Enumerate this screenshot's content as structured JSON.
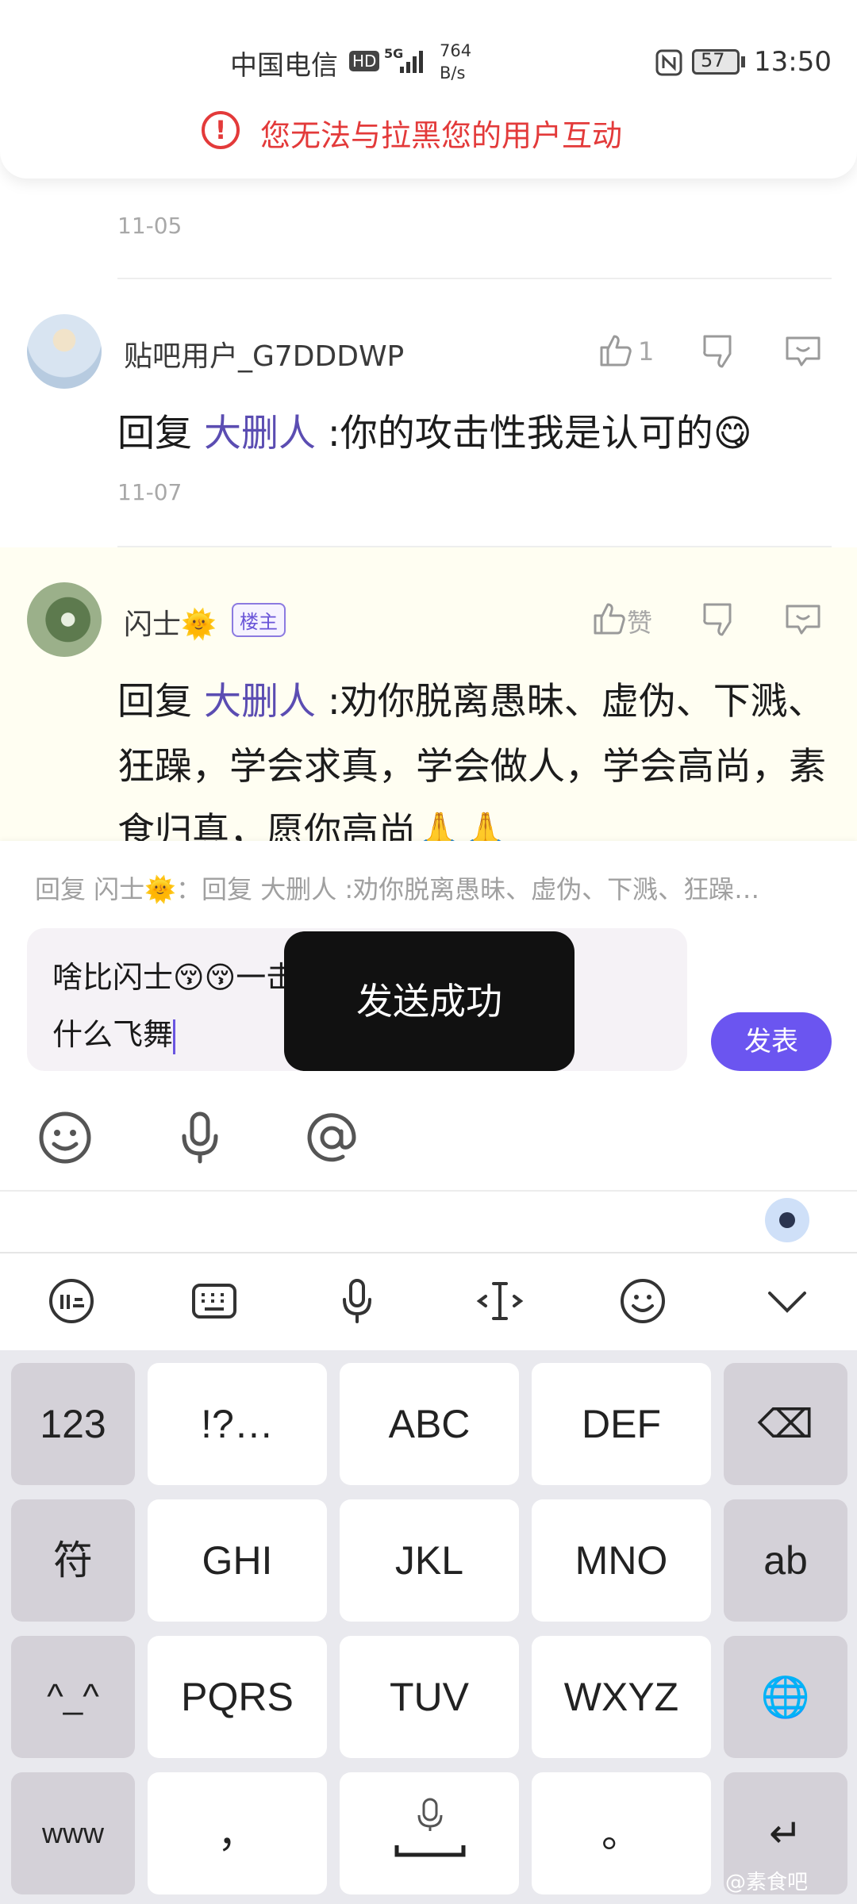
{
  "status_bar": {
    "carrier": "中国电信",
    "hd": "HD",
    "net": "5G",
    "speed_value": "764",
    "speed_unit": "B/s",
    "battery": "57",
    "time": "13:50"
  },
  "banner": {
    "text": "您无法与拉黑您的用户互动"
  },
  "comments": [
    {
      "date": "11-05"
    },
    {
      "user": "贴吧用户_G7DDDWP",
      "reply_prefix": "回复",
      "mention": "大删人",
      "text": ":你的攻击性我是认可的",
      "emoji": "😋",
      "like_count": "1",
      "date": "11-07"
    },
    {
      "user": "闪士🌞",
      "badge": "楼主",
      "reply_prefix": "回复",
      "mention": "大删人",
      "text": ":劝你脱离愚昧、虚伪、下溅、狂躁，学会求真，学会做人，学会高尚，素食归真，愿你高尚🙏🙏",
      "like_label": "赞"
    }
  ],
  "reply": {
    "quote": "回复 闪士🌞：回复 大删人 :劝你脱离愚昧、虚伪、下溅、狂躁…",
    "input_line1": "啥比闪士😚😚一击脱离，直接拉黑😚😚",
    "input_line2": "什么飞舞",
    "send": "发表"
  },
  "toast": "发送成功",
  "keyboard": {
    "rows": [
      [
        "123",
        "!?…",
        "ABC",
        "DEF",
        "⌫"
      ],
      [
        "符",
        "GHI",
        "JKL",
        "MNO",
        "ab"
      ],
      [
        "^_^",
        "PQRS",
        "TUV",
        "WXYZ",
        "🌐"
      ],
      [
        "www",
        "，",
        "space",
        "。",
        "↵"
      ]
    ]
  },
  "watermark": "@素食吧",
  "colors": {
    "accent": "#6b55f0",
    "warning": "#e33a3a",
    "mention": "#5b4db2"
  }
}
